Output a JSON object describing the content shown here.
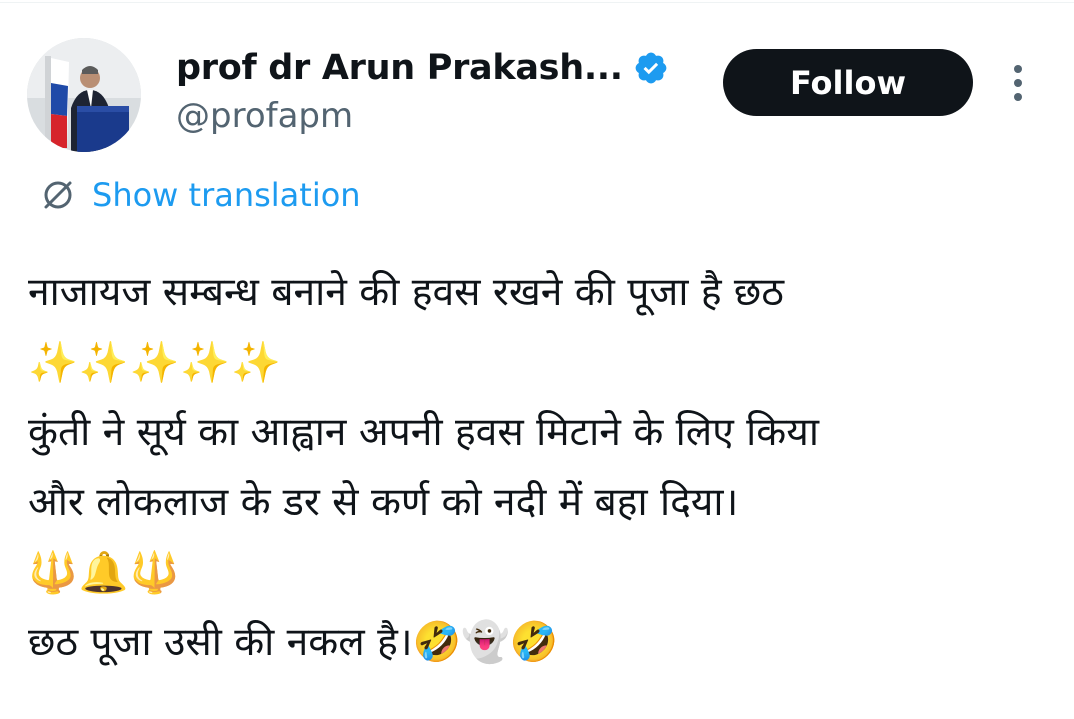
{
  "author": {
    "display_name": "prof dr Arun Prakash...",
    "handle": "@profapm",
    "verified_icon": "verified-badge-icon",
    "avatar": "avatar"
  },
  "actions": {
    "follow_label": "Follow",
    "more_icon": "more-vertical-icon"
  },
  "translation": {
    "label": "Show translation",
    "icon": "translate-globe-icon"
  },
  "tweet": {
    "lines": [
      "नाजायज सम्बन्ध बनाने की हवस रखने की पूजा है छठ",
      "✨✨✨✨✨",
      "कुंती ने सूर्य का आह्वान अपनी हवस मिटाने के लिए किया",
      "और लोकलाज के डर से कर्ण को नदी में बहा दिया।",
      "🔱🔔🔱",
      "छठ पूजा उसी की नकल है।🤣👻🤣"
    ]
  },
  "colors": {
    "text": "#0f1419",
    "secondary": "#536471",
    "link": "#1d9bf0",
    "button_bg": "#0f1419"
  }
}
